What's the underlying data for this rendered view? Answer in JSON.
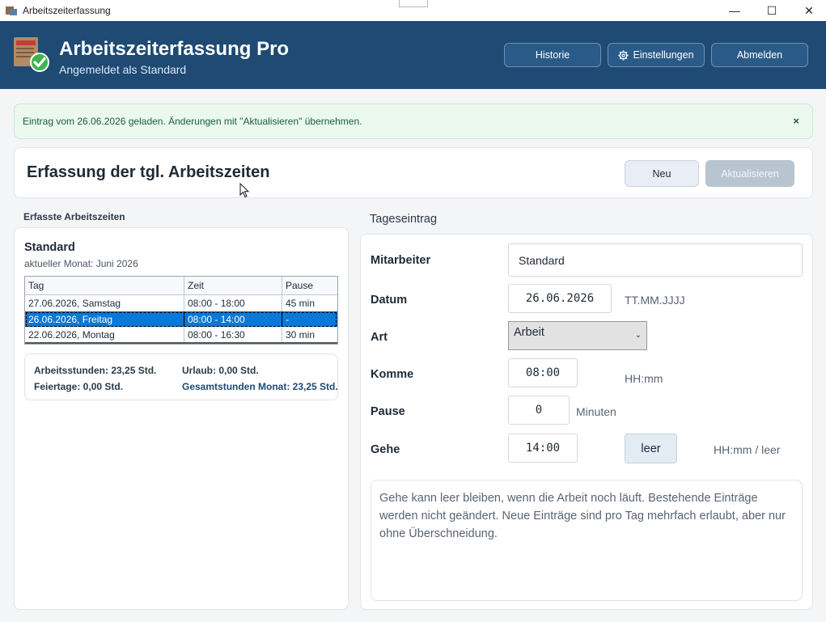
{
  "window": {
    "title": "Arbeitszeiterfassung",
    "controls": {
      "minimize": "—",
      "maximize": "☐",
      "close": "✕"
    }
  },
  "header": {
    "title": "Arbeitszeiterfassung Pro",
    "subtitle": "Angemeldet als Standard",
    "buttons": {
      "historie": "Historie",
      "einstellungen": "Einstellungen",
      "abmelden": "Abmelden"
    },
    "settings_icon": "gear-icon"
  },
  "notice": {
    "text": "Eintrag vom 26.06.2026 geladen. Änderungen mit \"Aktualisieren\" übernehmen.",
    "close": "×"
  },
  "page": {
    "heading": "Erfassung der tgl. Arbeitszeiten",
    "btn_new": "Neu",
    "btn_update": "Aktualisieren"
  },
  "left": {
    "section_label": "Erfasste Arbeitszeiten",
    "employee": "Standard",
    "month": "aktueller Monat: Juni 2026",
    "columns": [
      "Tag",
      "Zeit",
      "Pause"
    ],
    "rows": [
      {
        "tag": "27.06.2026, Samstag",
        "zeit": "08:00 - 18:00",
        "pause": "45 min"
      },
      {
        "tag": "26.06.2026, Freitag",
        "zeit": "08:00 - 14:00",
        "pause": "-"
      },
      {
        "tag": "22.06.2026, Montag",
        "zeit": "08:00 - 16:30",
        "pause": "30 min"
      }
    ],
    "selected_row": 1,
    "summary": {
      "arbeitsstunden": "Arbeitsstunden: 23,25 Std.",
      "urlaub": "Urlaub: 0,00 Std.",
      "feiertage": "Feiertage: 0,00 Std.",
      "gesamt": "Gesamtstunden Monat: 23,25 Std."
    }
  },
  "right": {
    "section_label": "Tageseintrag",
    "labels": {
      "mitarbeiter": "Mitarbeiter",
      "datum": "Datum",
      "art": "Art",
      "komme": "Komme",
      "pause": "Pause",
      "gehe": "Gehe"
    },
    "values": {
      "mitarbeiter": "Standard",
      "datum": "26.06.2026",
      "art": "Arbeit",
      "komme": "08:00",
      "pause": "0",
      "gehe": "14:00"
    },
    "hints": {
      "datum": "TT.MM.JJJJ",
      "komme": "HH:mm",
      "pause": "Minuten",
      "gehe": "HH:mm / leer"
    },
    "btn_leer": "leer",
    "info": "Gehe kann leer bleiben, wenn die Arbeit noch läuft. Bestehende Einträge werden nicht geändert. Neue Einträge sind pro Tag mehrfach erlaubt, aber nur ohne Überschneidung."
  },
  "colors": {
    "header_bg": "#1e4a74",
    "selection": "#0a78d6",
    "notice_bg": "#eaf8ee"
  }
}
